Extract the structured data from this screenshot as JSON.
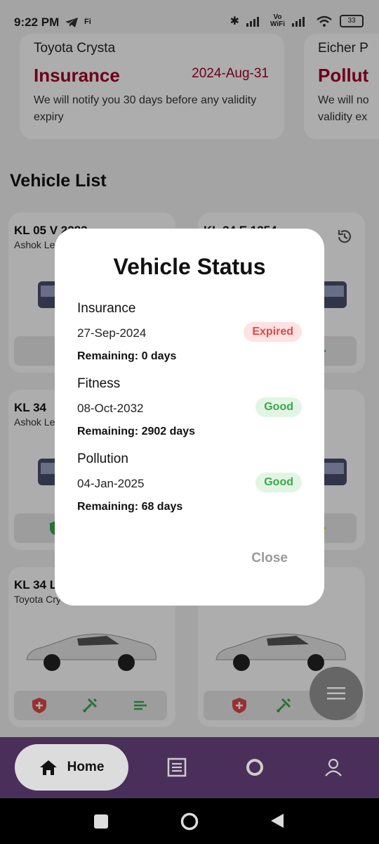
{
  "status_bar": {
    "time": "9:22 PM",
    "carrier_small": "Fi",
    "network_vo": "Vo",
    "network_wifi": "WiFi",
    "battery": "33"
  },
  "promo_cards": [
    {
      "model": "Toyota Crysta",
      "kind": "Insurance",
      "date": "2024-Aug-31",
      "note": "We will notify you 30 days before any validity expiry"
    },
    {
      "model": "Eicher P",
      "kind": "Pollut",
      "note": "We will no validity ex"
    }
  ],
  "section": {
    "title": "Vehicle List"
  },
  "vehicles": [
    {
      "number": "KL 05 V 2283",
      "make": "Ashok Le"
    },
    {
      "number": "KL 34 E 1354",
      "make": ""
    },
    {
      "number": "KL 34",
      "make": "Ashok Le"
    },
    {
      "number": "",
      "make": ""
    },
    {
      "number": "KL 34 L",
      "make": "Toyota Cry"
    },
    {
      "number": "",
      "make": ""
    }
  ],
  "dialog": {
    "title": "Vehicle Status",
    "items": [
      {
        "label": "Insurance",
        "date": "27-Sep-2024",
        "status": "Expired",
        "remaining": "Remaining: 0 days"
      },
      {
        "label": "Fitness",
        "date": "08-Oct-2032",
        "status": "Good",
        "remaining": "Remaining: 2902 days"
      },
      {
        "label": "Pollution",
        "date": "04-Jan-2025",
        "status": "Good",
        "remaining": "Remaining: 68 days"
      }
    ],
    "close_label": "Close"
  },
  "bottom_nav": {
    "home_label": "Home"
  },
  "colors": {
    "accent": "#a0002a",
    "nav_bg": "#4a2f5a",
    "expired": "#e04848",
    "good": "#3aa84a"
  }
}
